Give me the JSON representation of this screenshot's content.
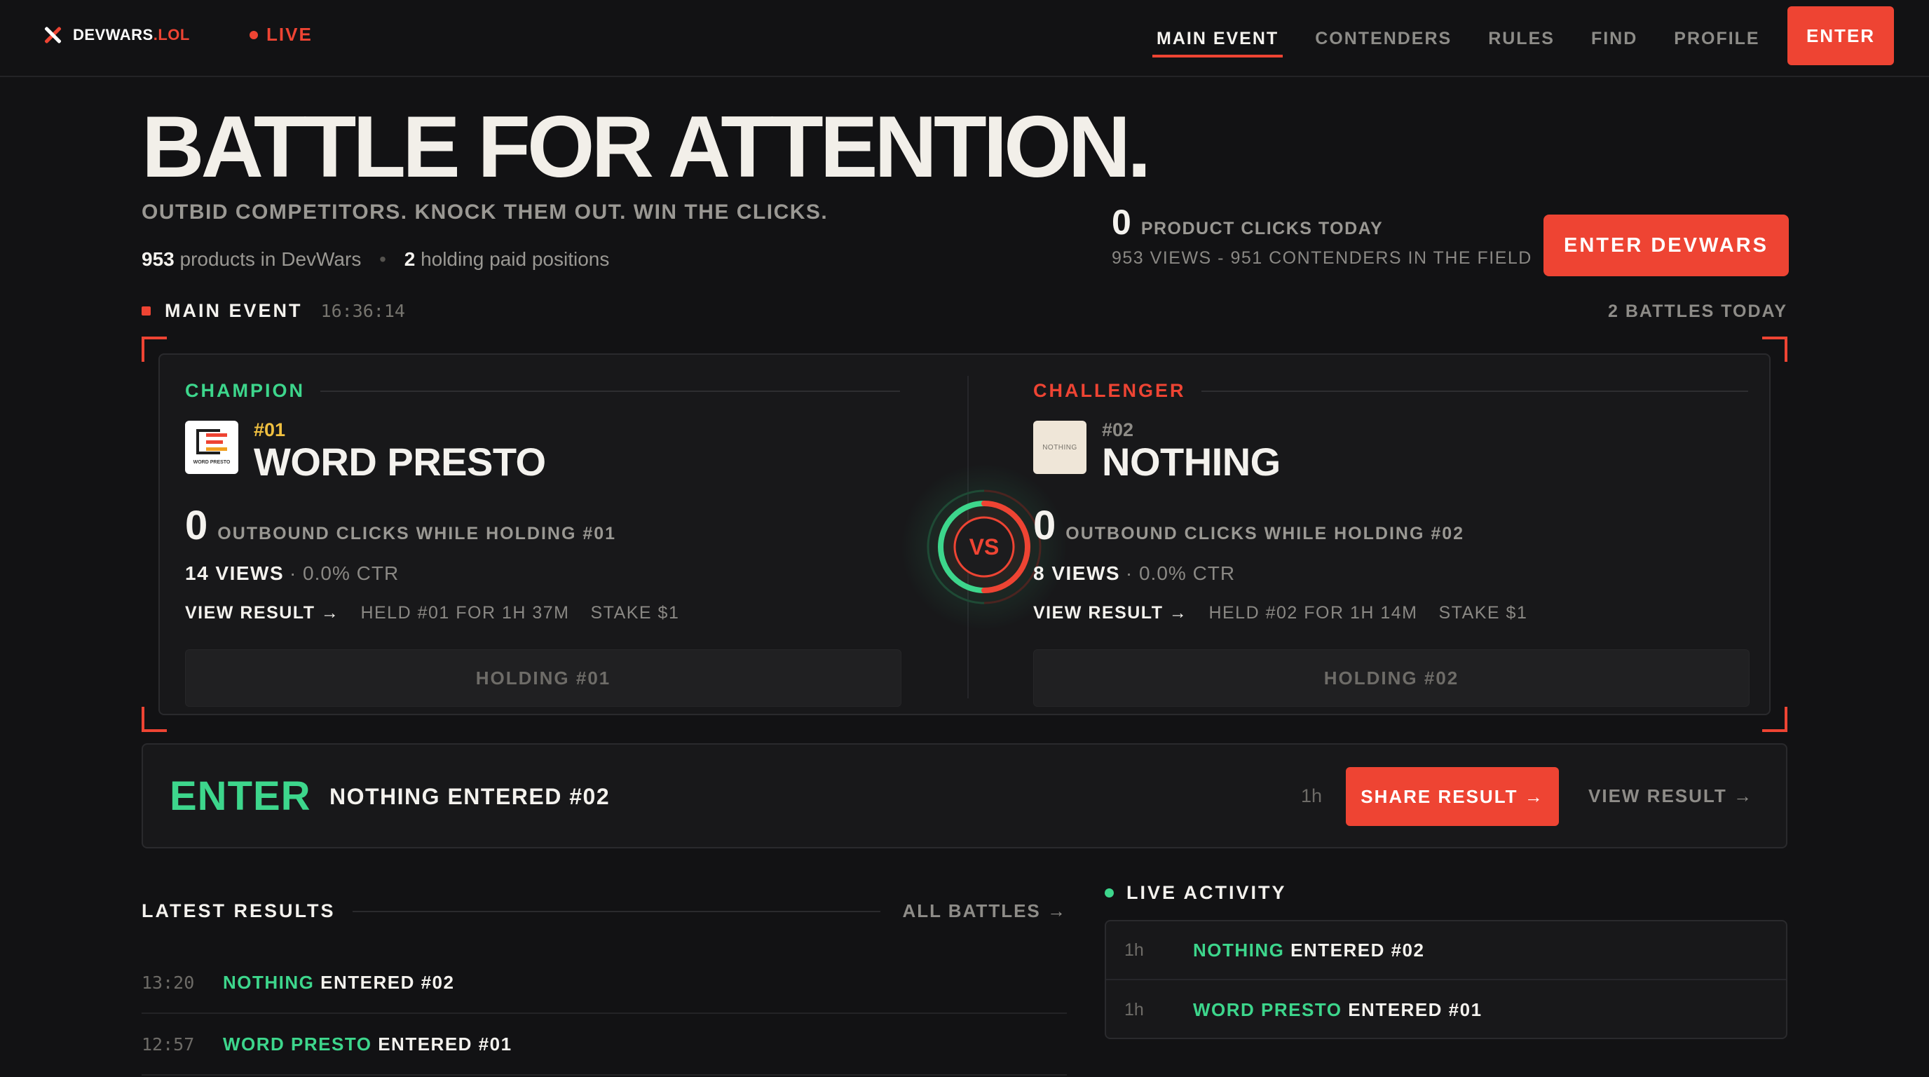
{
  "nav": {
    "brand": "DEVWARS",
    "brand_tld": ".LOL",
    "live_label": "LIVE",
    "links": [
      {
        "label": "MAIN EVENT",
        "active": true
      },
      {
        "label": "CONTENDERS",
        "active": false
      },
      {
        "label": "RULES",
        "active": false
      },
      {
        "label": "FIND",
        "active": false
      },
      {
        "label": "PROFILE",
        "active": false
      }
    ],
    "enter_label": "ENTER"
  },
  "hero": {
    "title": "BATTLE FOR ATTENTION.",
    "subtitle": "OUTBID COMPETITORS. KNOCK THEM OUT. WIN THE CLICKS.",
    "products_count": "953",
    "products_label": "products in DevWars",
    "holding_count": "2",
    "holding_label": "holding paid positions",
    "clicks_today": "0",
    "clicks_label": "PRODUCT CLICKS TODAY",
    "views_contenders": "953 VIEWS - 951 CONTENDERS IN THE FIELD",
    "cta_label": "ENTER DEVWARS"
  },
  "main_event": {
    "title": "MAIN EVENT",
    "time": "16:36:14",
    "battles_today": "2 BATTLES TODAY",
    "vs_label": "VS",
    "champion": {
      "role": "CHAMPION",
      "rank": "#01",
      "name": "WORD PRESTO",
      "logo_text": "WORD PRESTO",
      "outbound_clicks": "0",
      "outbound_label": "OUTBOUND CLICKS WHILE HOLDING #01",
      "views": "14 VIEWS",
      "ctr": "· 0.0% CTR",
      "view_result": "VIEW RESULT →",
      "held": "HELD #01 FOR 1H 37M",
      "stake": "STAKE $1",
      "holding_button": "HOLDING #01"
    },
    "challenger": {
      "role": "CHALLENGER",
      "rank": "#02",
      "name": "NOTHING",
      "logo_text": "NOTHING",
      "outbound_clicks": "0",
      "outbound_label": "OUTBOUND CLICKS WHILE HOLDING #02",
      "views": "8 VIEWS",
      "ctr": "· 0.0% CTR",
      "view_result": "VIEW RESULT →",
      "held": "HELD #02 FOR 1H 14M",
      "stake": "STAKE $1",
      "holding_button": "HOLDING #02"
    }
  },
  "enter_strip": {
    "word": "ENTER",
    "text": "NOTHING ENTERED #02",
    "time": "1h",
    "share_label": "SHARE RESULT →",
    "view_label": "VIEW RESULT →"
  },
  "latest_results": {
    "title": "LATEST RESULTS",
    "all_label": "ALL BATTLES →",
    "rows": [
      {
        "time": "13:20",
        "name": "NOTHING",
        "action": " ENTERED #02"
      },
      {
        "time": "12:57",
        "name": "WORD PRESTO",
        "action": " ENTERED #01"
      }
    ]
  },
  "live_activity": {
    "title": "LIVE ACTIVITY",
    "rows": [
      {
        "time": "1h",
        "name": "NOTHING",
        "action": " ENTERED #02"
      },
      {
        "time": "1h",
        "name": "WORD PRESTO",
        "action": " ENTERED #01"
      }
    ]
  },
  "colors": {
    "accent_red": "#ee4433",
    "accent_green": "#3dd68c",
    "rank_gold": "#f0c040",
    "background": "#121214"
  }
}
